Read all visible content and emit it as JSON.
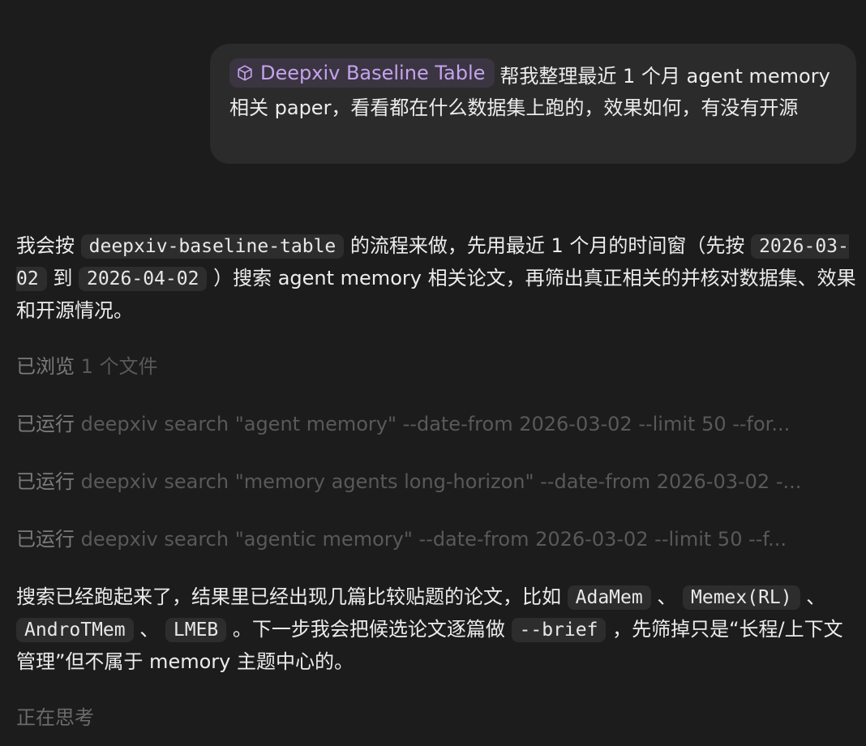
{
  "user_message": {
    "chip_label": "Deepxiv Baseline Table",
    "text": "帮我整理最近 1 个月 agent memory 相关 paper，看看都在什么数据集上跑的，效果如何，有没有开源"
  },
  "assistant_intro": {
    "t1": "我会按 ",
    "code1": "deepxiv-baseline-table",
    "t2": " 的流程来做，先用最近 1 个月的时间窗（先按 ",
    "code2": "2026-03-02",
    "t3": " 到 ",
    "code3": "2026-04-02",
    "t4": " ）搜索 agent memory 相关论文，再筛出真正相关的并核对数据集、效果和开源情况。"
  },
  "activity": [
    {
      "label": "已浏览",
      "detail": "1 个文件"
    },
    {
      "label": "已运行",
      "detail": "deepxiv search \"agent memory\" --date-from 2026-03-02 --limit 50 --for..."
    },
    {
      "label": "已运行",
      "detail": "deepxiv search \"memory agents long-horizon\" --date-from 2026-03-02 -..."
    },
    {
      "label": "已运行",
      "detail": "deepxiv search \"agentic memory\" --date-from 2026-03-02 --limit 50 --f..."
    }
  ],
  "assistant_followup": {
    "t1": "搜索已经跑起来了，结果里已经出现几篇比较贴题的论文，比如 ",
    "code1": "AdaMem",
    "t2": " 、 ",
    "code2": "Memex(RL)",
    "t3": " 、 ",
    "code3": "AndroTMem",
    "t4": " 、 ",
    "code4": "LMEB",
    "t5": " 。下一步我会把候选论文逐篇做 ",
    "code5": "--brief",
    "t6": " ，先筛掉只是“长程/上下文管理”但不属于 memory 主题中心的。"
  },
  "status": "正在思考",
  "colors": {
    "background": "#1c1c1c",
    "bubble": "#2b2b2b",
    "chip_bg": "#3b3542",
    "chip_text": "#c4a3ec",
    "muted": "#6b6b6b"
  }
}
